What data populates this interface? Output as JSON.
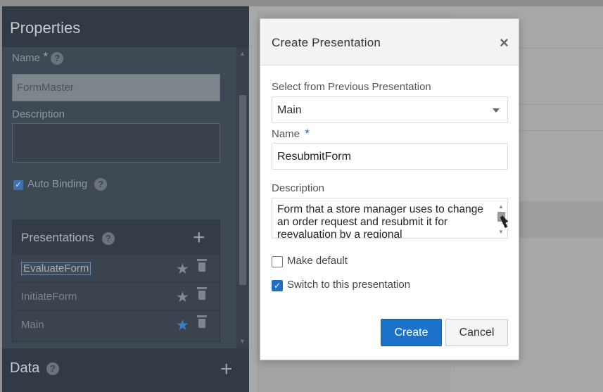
{
  "properties": {
    "title": "Properties",
    "name_label": "Name",
    "name_value": "FormMaster",
    "description_label": "Description",
    "auto_binding_label": "Auto Binding",
    "presentations_title": "Presentations",
    "presentations": [
      {
        "label": "EvaluateForm",
        "selected": true
      },
      {
        "label": "InitiateForm",
        "selected": false
      },
      {
        "label": "Main",
        "selected": false
      }
    ],
    "data_title": "Data"
  },
  "dialog": {
    "title": "Create Presentation",
    "close_label": "×",
    "select_label": "Select from Previous Presentation",
    "select_value": "Main",
    "name_label": "Name",
    "name_value": "ResubmitForm",
    "description_label": "Description",
    "description_value": "Form that a store manager uses to change an order request and resubmit it for reevaluation by a regional",
    "make_default_label": "Make default",
    "switch_label": "Switch to this presentation",
    "create_label": "Create",
    "cancel_label": "Cancel"
  },
  "colors": {
    "accent": "#1a72c9",
    "panel_bg": "#3d4752",
    "header_bg": "#323b45"
  }
}
